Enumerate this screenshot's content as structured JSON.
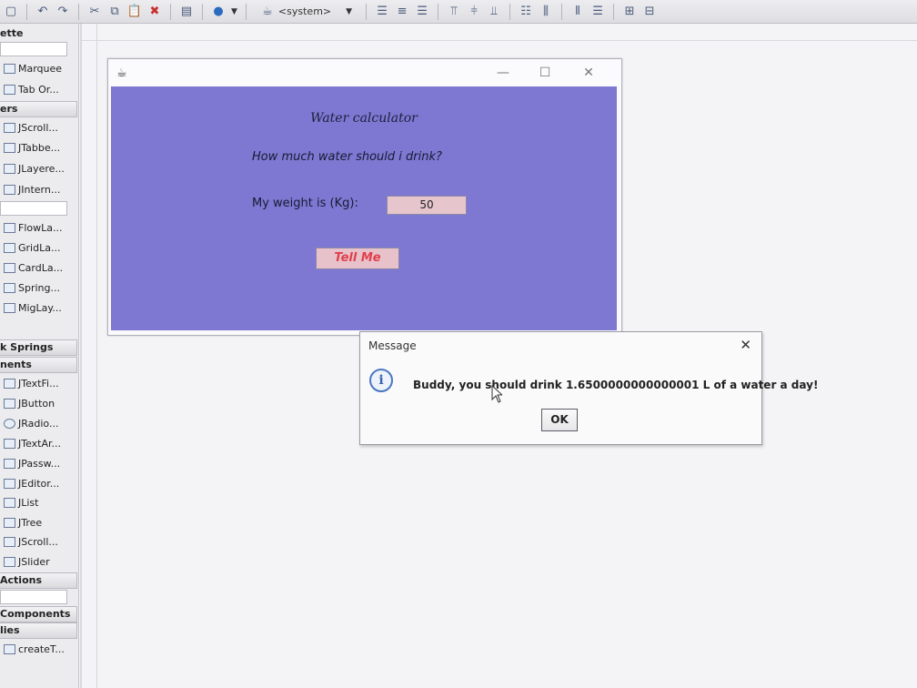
{
  "toolbar": {
    "combo_label": "<system>"
  },
  "palette": {
    "title_fragment": "ette",
    "headers": [
      "ers",
      "k Springs",
      "nents",
      "Actions",
      "Components",
      "lies"
    ],
    "items": [
      {
        "label": "Marquee",
        "icon": "marquee-icon"
      },
      {
        "label": "Tab Or...",
        "icon": "tab-order-icon"
      },
      {
        "label": "JScroll...",
        "icon": "scrollpane-icon"
      },
      {
        "label": "JTabbe...",
        "icon": "tabbedpane-icon"
      },
      {
        "label": "JLayere...",
        "icon": "layeredpane-icon"
      },
      {
        "label": "JIntern...",
        "icon": "internalframe-icon"
      },
      {
        "label": "FlowLa...",
        "icon": "flowlayout-icon"
      },
      {
        "label": "GridLa...",
        "icon": "gridlayout-icon"
      },
      {
        "label": "CardLa...",
        "icon": "cardlayout-icon"
      },
      {
        "label": "Spring...",
        "icon": "springlayout-icon"
      },
      {
        "label": "MigLay...",
        "icon": "miglayout-icon"
      },
      {
        "label": "JTextFi...",
        "icon": "textfield-icon"
      },
      {
        "label": "JButton",
        "icon": "button-icon"
      },
      {
        "label": "JRadio...",
        "icon": "radio-icon"
      },
      {
        "label": "JTextAr...",
        "icon": "textarea-icon"
      },
      {
        "label": "JPassw...",
        "icon": "password-icon"
      },
      {
        "label": "JEditor...",
        "icon": "editorpane-icon"
      },
      {
        "label": "JList",
        "icon": "list-icon"
      },
      {
        "label": "JTree",
        "icon": "tree-icon"
      },
      {
        "label": "JScroll...",
        "icon": "scrollbar-icon"
      },
      {
        "label": "JSlider",
        "icon": "slider-icon"
      },
      {
        "label": "createT...",
        "icon": "factory-icon"
      }
    ]
  },
  "frame": {
    "heading": "Water calculator",
    "question": "How much water should i drink?",
    "weight_label": "My weight is (Kg):",
    "weight_value": "50",
    "button_label": "Tell Me"
  },
  "dialog": {
    "title": "Message",
    "message": "Buddy, you should drink 1.6500000000000001 L of a water a day!",
    "ok_label": "OK"
  }
}
